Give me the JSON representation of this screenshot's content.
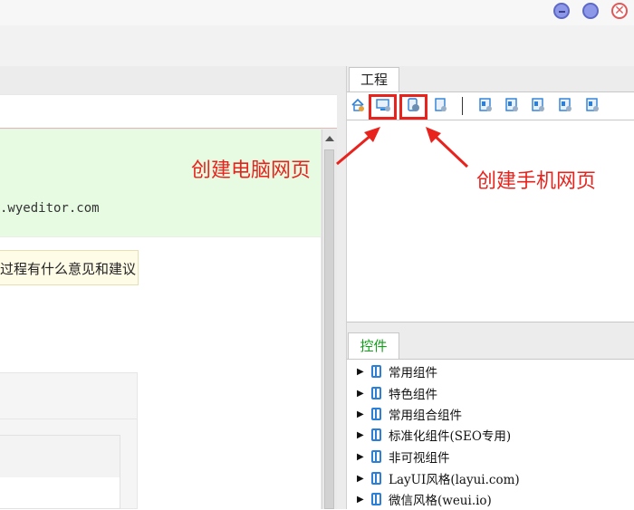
{
  "window": {
    "title": "",
    "controls": [
      "minimize",
      "maximize",
      "close"
    ]
  },
  "editor": {
    "url_text": ".wyeditor.com",
    "note_text": "过程有什么意见和建议"
  },
  "project_panel": {
    "tab_label": "工程",
    "toolbar_icons": [
      "home-icon",
      "new-pc-page-icon",
      "new-mobile-page-icon",
      "page-icon",
      "page-a-icon",
      "page-b-icon",
      "page-c-icon",
      "page-d-icon",
      "page-e-icon"
    ]
  },
  "controls_panel": {
    "tab_label": "控件",
    "items": [
      {
        "label": "常用组件"
      },
      {
        "label": "特色组件"
      },
      {
        "label": "常用组合组件"
      },
      {
        "label": "标准化组件(SEO专用)"
      },
      {
        "label": "非可视组件"
      },
      {
        "label": "LayUI风格(layui.com)"
      },
      {
        "label": "微信风格(weui.io)"
      }
    ]
  },
  "annotations": {
    "pc_label": "创建电脑网页",
    "mobile_label": "创建手机网页",
    "color": "#e8231d"
  }
}
